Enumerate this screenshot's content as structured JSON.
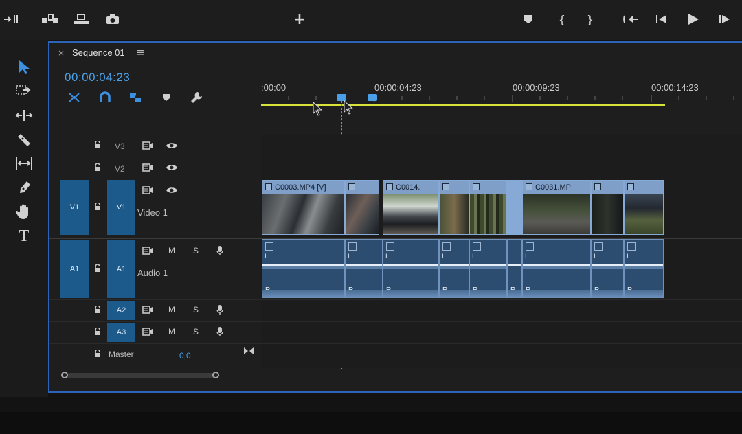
{
  "toolbar": {
    "icons": [
      "insert-icon",
      "lift-icon",
      "extract-icon",
      "camera-icon",
      "add-icon",
      "marker-icon",
      "mark-in-icon",
      "mark-out-icon",
      "go-to-in-icon",
      "step-back-icon",
      "play-icon",
      "step-forward-icon"
    ]
  },
  "tools": [
    "selection-tool-icon",
    "track-select-tool-icon",
    "ripple-edit-tool-icon",
    "razor-tool-icon",
    "slip-tool-icon",
    "pen-tool-icon",
    "hand-tool-icon",
    "type-tool-icon"
  ],
  "sequence": {
    "close": "×",
    "name": "Sequence 01",
    "menu": "≡",
    "timecode": "00:00:04:23"
  },
  "ruler": {
    "labels": [
      ":00:00",
      "00:00:04:23",
      "00:00:09:23",
      "00:00:14:23"
    ]
  },
  "tracks": {
    "v3": {
      "label": "V3"
    },
    "v2": {
      "label": "V2"
    },
    "v1": {
      "source": "V1",
      "label": "V1",
      "name": "Video 1"
    },
    "a1": {
      "source": "A1",
      "label": "A1",
      "name": "Audio 1",
      "m": "M",
      "s": "S"
    },
    "a2": {
      "label": "A2",
      "m": "M",
      "s": "S"
    },
    "a3": {
      "label": "A3",
      "m": "M",
      "s": "S"
    },
    "master": {
      "name": "Master",
      "value": "0,0"
    }
  },
  "clips": {
    "video": [
      "C0003.MP4 [V]",
      "",
      "C0014.",
      "",
      "",
      "C0031.MP",
      "",
      ""
    ],
    "audio_l": "L",
    "audio_r": "R"
  },
  "colors": {
    "accent": "#2d63b8",
    "track_blue": "#1d5a8c",
    "timecode_blue": "#4b9fe6",
    "work_area": "#d8e23a"
  }
}
